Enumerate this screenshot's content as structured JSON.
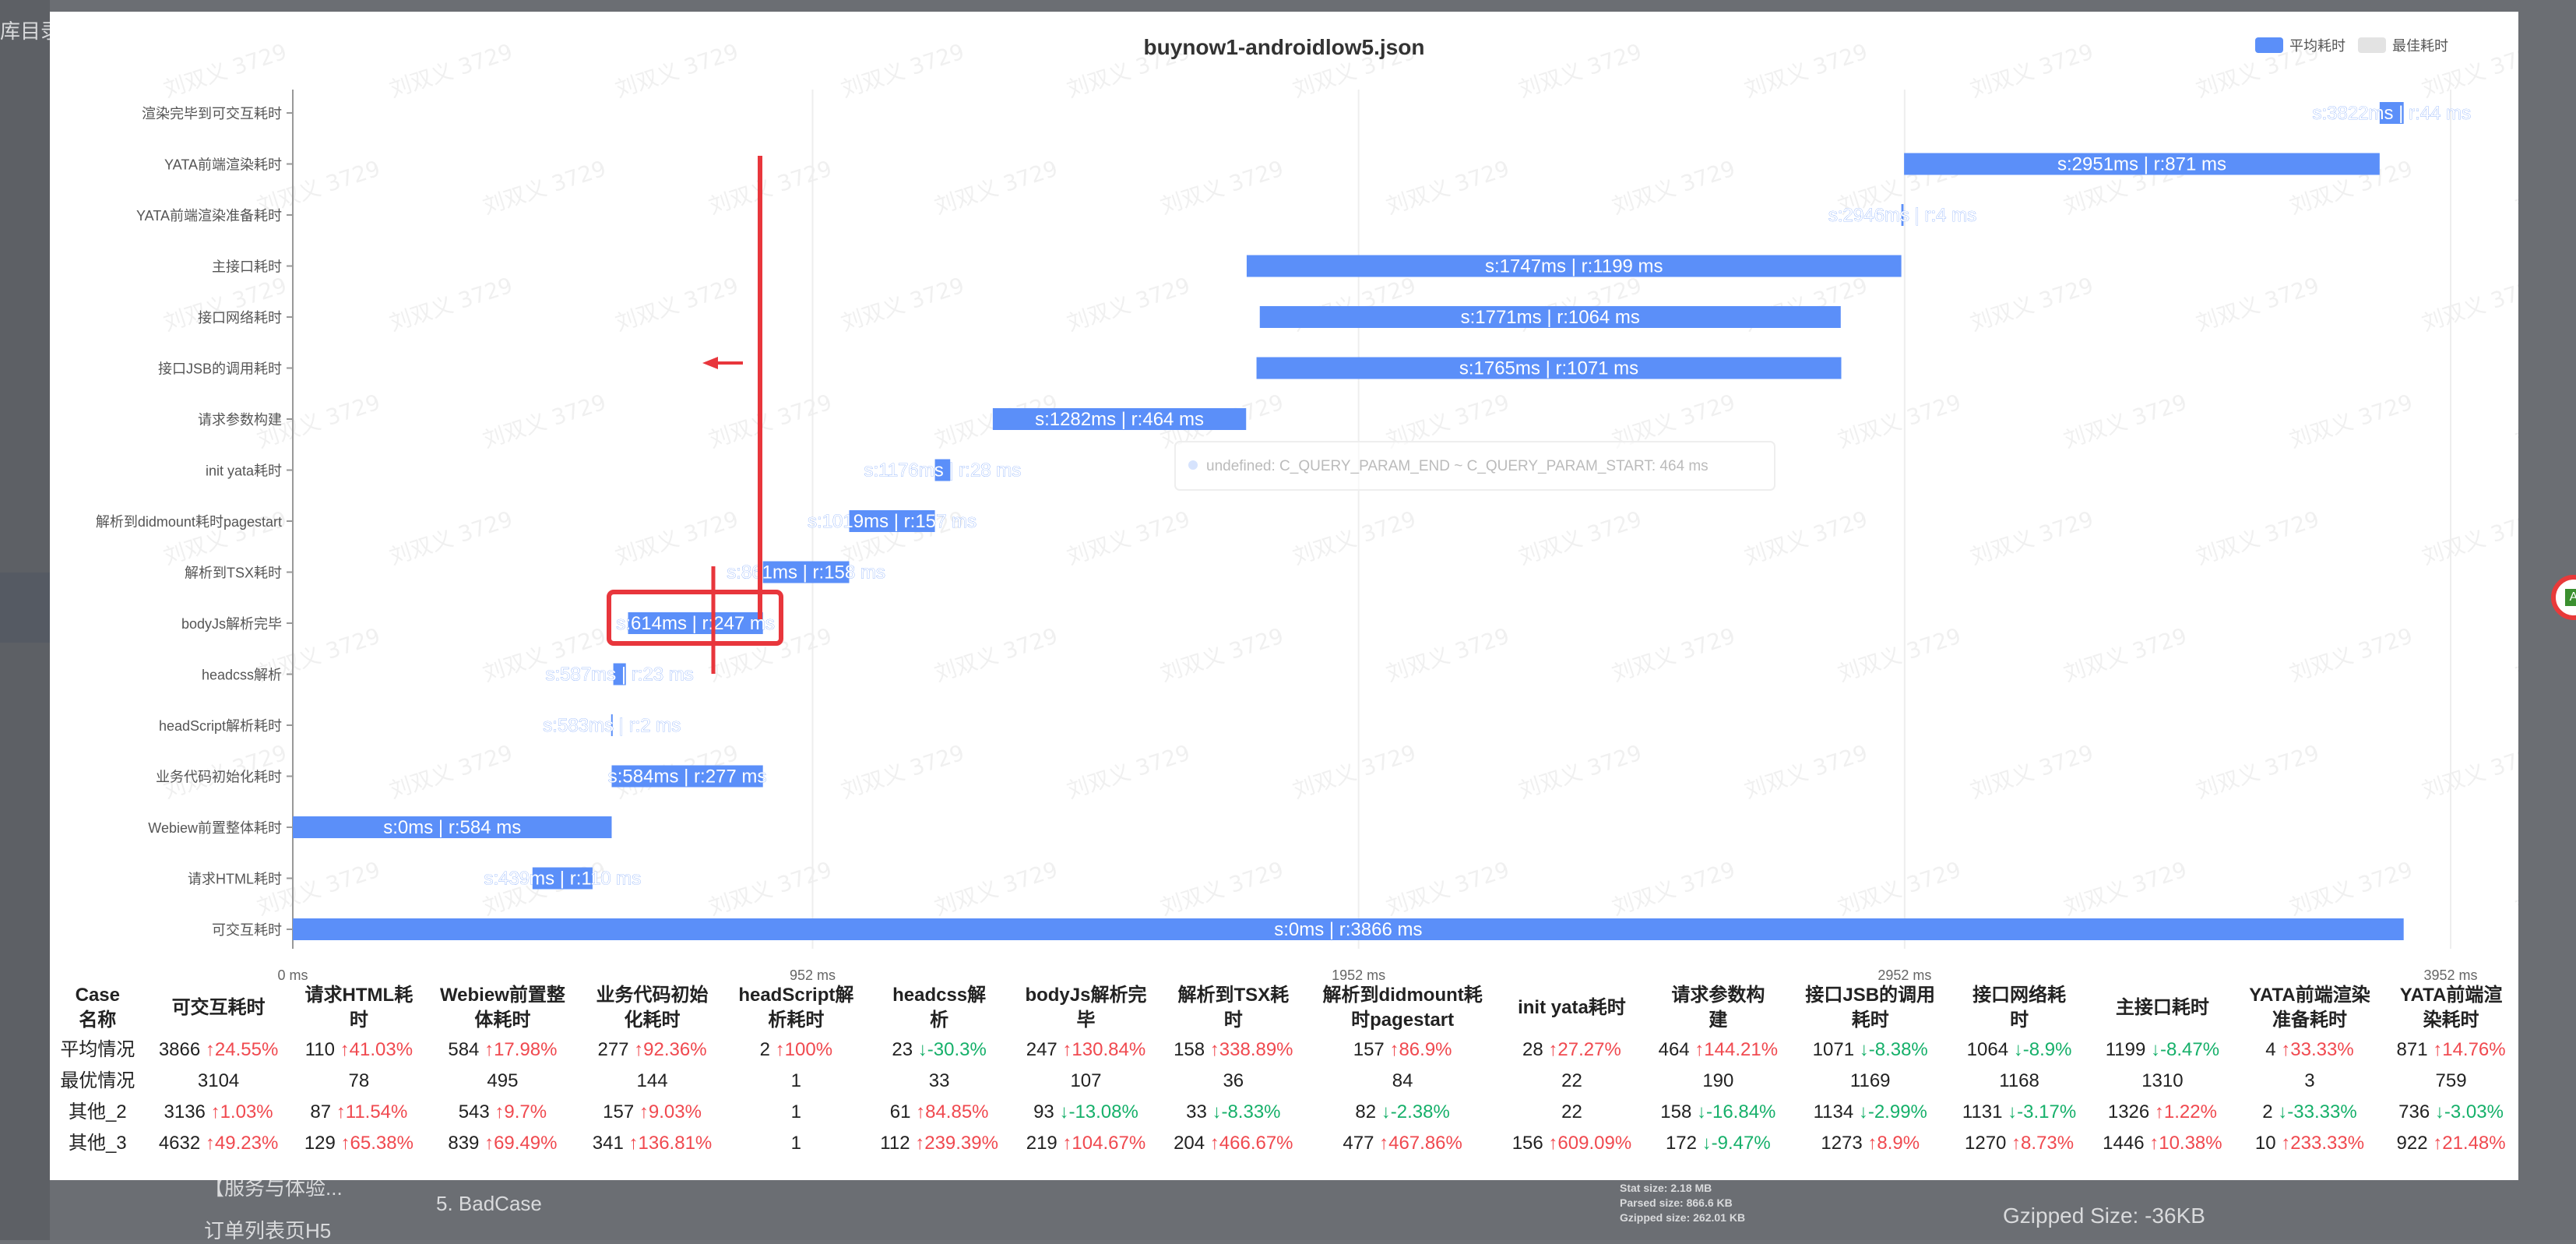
{
  "background": {
    "top_left_text": "库目录",
    "bottom_items": [
      "【服务与体验...",
      "订单列表页H5",
      "5. BadCase",
      "Gzipped Size: -36KB"
    ],
    "stats": [
      "Stat size: 2.18 MB",
      "Parsed size: 866.6 KB",
      "Gzipped size: 262.01 KB"
    ]
  },
  "title": "buynow1-androidlow5.json",
  "legend": [
    {
      "label": "平均耗时",
      "color": "#5b8ff9"
    },
    {
      "label": "最佳耗时",
      "color": "#e3e3e3"
    }
  ],
  "colors": {
    "bar": "#5b8ff9",
    "up": "#f0494f",
    "down": "#16b06a",
    "annotation": "#e8363c"
  },
  "watermark": "刘双义 3729",
  "tooltip_text": "undefined: C_QUERY_PARAM_END ~ C_QUERY_PARAM_START: 464 ms",
  "chart_data": {
    "type": "bar",
    "orientation": "horizontal",
    "title": "buynow1-androidlow5.json",
    "categories": [
      "渲染完毕到可交互耗时",
      "YATA前端渲染耗时",
      "YATA前端渲染准备耗时",
      "主接口耗时",
      "接口网络耗时",
      "接口JSB的调用耗时",
      "请求参数构建",
      "init yata耗时",
      "解析到didmount耗时pagestart",
      "解析到TSX耗时",
      "bodyJs解析完毕",
      "headcss解析",
      "headScript解析耗时",
      "业务代码初始化耗时",
      "Webiew前置整体耗时",
      "请求HTML耗时",
      "可交互耗时"
    ],
    "start": [
      3822,
      2951,
      2946,
      1747,
      1771,
      1765,
      1282,
      1176,
      1019,
      861,
      614,
      587,
      583,
      584,
      0,
      439,
      0
    ],
    "duration": [
      44,
      871,
      4,
      1199,
      1064,
      1071,
      464,
      28,
      157,
      158,
      247,
      23,
      2,
      277,
      584,
      110,
      3866
    ],
    "labels": [
      "s:3822ms | r:44 ms",
      "s:2951ms | r:871 ms",
      "s:2946ms | r:4 ms",
      "s:1747ms | r:1199 ms",
      "s:1771ms | r:1064 ms",
      "s:1765ms | r:1071 ms",
      "s:1282ms | r:464 ms",
      "s:1176ms | r:28 ms",
      "s:1019ms | r:157 ms",
      "s:861ms | r:158 ms",
      "s:614ms | r:247 ms",
      "s:587ms | r:23 ms",
      "s:583ms | r:2 ms",
      "s:584ms | r:277 ms",
      "s:0ms | r:584 ms",
      "s:439ms | r:110 ms",
      "s:0ms | r:3866 ms"
    ],
    "xlim": [
      0,
      3952
    ],
    "xticks": [
      0,
      952,
      1952,
      2952,
      3952
    ],
    "xtick_labels": [
      "0 ms",
      "952 ms",
      "1952 ms",
      "2952 ms",
      "3952 ms"
    ],
    "grid": true,
    "legend_position": "top-right"
  },
  "table": {
    "headers": [
      "Case名称",
      "可交互耗时",
      "请求HTML耗时",
      "Webiew前置整体耗时",
      "业务代码初始化耗时",
      "headScript解析耗时",
      "headcss解析",
      "bodyJs解析完毕",
      "解析到TSX耗时",
      "解析到didmount耗时pagestart",
      "init yata耗时",
      "请求参数构建",
      "接口JSB的调用耗时",
      "接口网络耗时",
      "主接口耗时",
      "YATA前端渲染准备耗时",
      "YATA前端渲染耗时"
    ],
    "header_lines": [
      [
        "Case",
        "名称"
      ],
      [
        "可交互耗时"
      ],
      [
        "请求HTML耗",
        "时"
      ],
      [
        "Webiew前置整",
        "体耗时"
      ],
      [
        "业务代码初始",
        "化耗时"
      ],
      [
        "headScript解",
        "析耗时"
      ],
      [
        "headcss解",
        "析"
      ],
      [
        "bodyJs解析完",
        "毕"
      ],
      [
        "解析到TSX耗",
        "时"
      ],
      [
        "解析到didmount耗",
        "时pagestart"
      ],
      [
        "init yata耗时"
      ],
      [
        "请求参数构",
        "建"
      ],
      [
        "接口JSB的调用",
        "耗时"
      ],
      [
        "接口网络耗",
        "时"
      ],
      [
        "主接口耗时"
      ],
      [
        "YATA前端渲染",
        "准备耗时"
      ],
      [
        "YATA前端渲",
        "染耗时"
      ]
    ],
    "rows": [
      {
        "name": "平均情况",
        "cells": [
          {
            "v": "3866",
            "d": "↑24.55%",
            "t": "up"
          },
          {
            "v": "110",
            "d": "↑41.03%",
            "t": "up"
          },
          {
            "v": "584",
            "d": "↑17.98%",
            "t": "up"
          },
          {
            "v": "277",
            "d": "↑92.36%",
            "t": "up"
          },
          {
            "v": "2",
            "d": "↑100%",
            "t": "up"
          },
          {
            "v": "23",
            "d": "↓-30.3%",
            "t": "down"
          },
          {
            "v": "247",
            "d": "↑130.84%",
            "t": "up"
          },
          {
            "v": "158",
            "d": "↑338.89%",
            "t": "up"
          },
          {
            "v": "157",
            "d": "↑86.9%",
            "t": "up"
          },
          {
            "v": "28",
            "d": "↑27.27%",
            "t": "up"
          },
          {
            "v": "464",
            "d": "↑144.21%",
            "t": "up"
          },
          {
            "v": "1071",
            "d": "↓-8.38%",
            "t": "down"
          },
          {
            "v": "1064",
            "d": "↓-8.9%",
            "t": "down"
          },
          {
            "v": "1199",
            "d": "↓-8.47%",
            "t": "down"
          },
          {
            "v": "4",
            "d": "↑33.33%",
            "t": "up"
          },
          {
            "v": "871",
            "d": "↑14.76%",
            "t": "up"
          }
        ]
      },
      {
        "name": "最优情况",
        "cells": [
          {
            "v": "3104"
          },
          {
            "v": "78"
          },
          {
            "v": "495"
          },
          {
            "v": "144"
          },
          {
            "v": "1"
          },
          {
            "v": "33"
          },
          {
            "v": "107"
          },
          {
            "v": "36"
          },
          {
            "v": "84"
          },
          {
            "v": "22"
          },
          {
            "v": "190"
          },
          {
            "v": "1169"
          },
          {
            "v": "1168"
          },
          {
            "v": "1310"
          },
          {
            "v": "3"
          },
          {
            "v": "759"
          }
        ]
      },
      {
        "name": "其他_2",
        "cells": [
          {
            "v": "3136",
            "d": "↑1.03%",
            "t": "up"
          },
          {
            "v": "87",
            "d": "↑11.54%",
            "t": "up"
          },
          {
            "v": "543",
            "d": "↑9.7%",
            "t": "up"
          },
          {
            "v": "157",
            "d": "↑9.03%",
            "t": "up"
          },
          {
            "v": "1"
          },
          {
            "v": "61",
            "d": "↑84.85%",
            "t": "up"
          },
          {
            "v": "93",
            "d": "↓-13.08%",
            "t": "down"
          },
          {
            "v": "33",
            "d": "↓-8.33%",
            "t": "down"
          },
          {
            "v": "82",
            "d": "↓-2.38%",
            "t": "down"
          },
          {
            "v": "22"
          },
          {
            "v": "158",
            "d": "↓-16.84%",
            "t": "down"
          },
          {
            "v": "1134",
            "d": "↓-2.99%",
            "t": "down"
          },
          {
            "v": "1131",
            "d": "↓-3.17%",
            "t": "down"
          },
          {
            "v": "1326",
            "d": "↑1.22%",
            "t": "up"
          },
          {
            "v": "2",
            "d": "↓-33.33%",
            "t": "down"
          },
          {
            "v": "736",
            "d": "↓-3.03%",
            "t": "down"
          }
        ]
      },
      {
        "name": "其他_3",
        "cells": [
          {
            "v": "4632",
            "d": "↑49.23%",
            "t": "up"
          },
          {
            "v": "129",
            "d": "↑65.38%",
            "t": "up"
          },
          {
            "v": "839",
            "d": "↑69.49%",
            "t": "up"
          },
          {
            "v": "341",
            "d": "↑136.81%",
            "t": "up"
          },
          {
            "v": "1"
          },
          {
            "v": "112",
            "d": "↑239.39%",
            "t": "up"
          },
          {
            "v": "219",
            "d": "↑104.67%",
            "t": "up"
          },
          {
            "v": "204",
            "d": "↑466.67%",
            "t": "up"
          },
          {
            "v": "477",
            "d": "↑467.86%",
            "t": "up"
          },
          {
            "v": "156",
            "d": "↑609.09%",
            "t": "up"
          },
          {
            "v": "172",
            "d": "↓-9.47%",
            "t": "down"
          },
          {
            "v": "1273",
            "d": "↑8.9%",
            "t": "up"
          },
          {
            "v": "1270",
            "d": "↑8.73%",
            "t": "up"
          },
          {
            "v": "1446",
            "d": "↑10.38%",
            "t": "up"
          },
          {
            "v": "10",
            "d": "↑233.33%",
            "t": "up"
          },
          {
            "v": "922",
            "d": "↑21.48%",
            "t": "up"
          }
        ]
      }
    ]
  }
}
